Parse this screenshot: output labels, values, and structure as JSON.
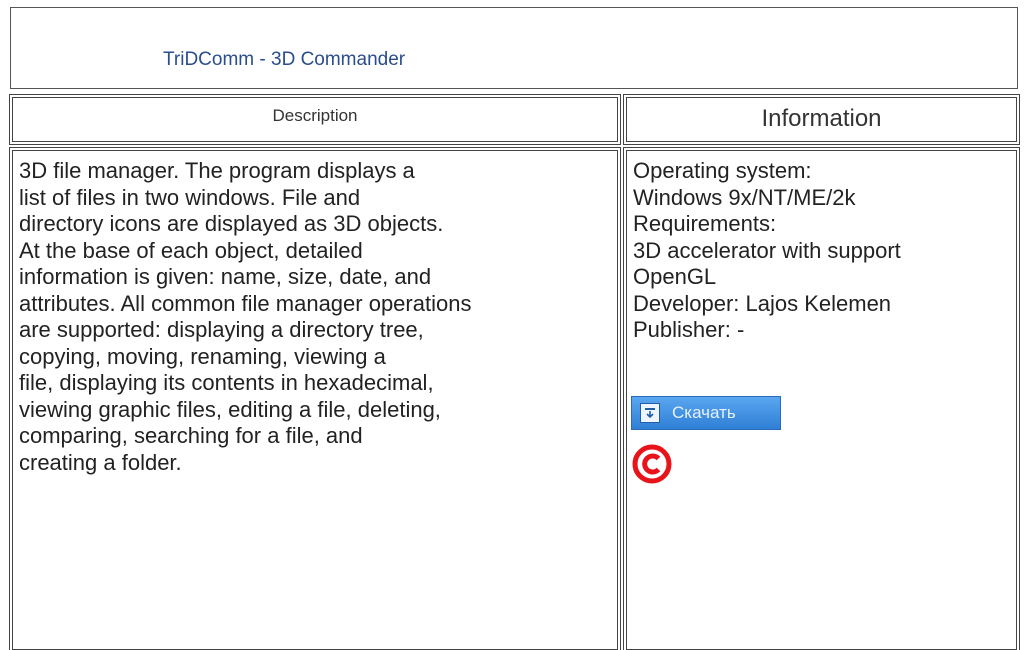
{
  "page": {
    "title": "TriDComm - 3D Commander"
  },
  "table": {
    "headers": {
      "description": "Description",
      "information": "Information"
    },
    "description_lines": [
      "3D file manager. The program displays a",
      "list of files in two windows. File and",
      "directory icons are displayed as 3D objects.",
      "At the base of each object, detailed",
      "information is given: name, size, date, and",
      "attributes. All common file manager operations",
      "are supported: displaying a directory tree,",
      "copying, moving, renaming, viewing a",
      "file, displaying its contents in hexadecimal,",
      "viewing graphic files, editing a file, deleting,",
      "comparing, searching for a file, and",
      "creating a folder."
    ],
    "information_lines": [
      "Operating system:",
      "Windows 9x/NT/ME/2k",
      "Requirements:",
      "3D accelerator with support",
      "OpenGL",
      "Developer: Lajos Kelemen",
      "Publisher: -"
    ],
    "download_button": {
      "label": "Скачать",
      "icon": "download-arrow-icon",
      "color": "#2f7fd6"
    },
    "copyright_icon": {
      "icon": "copyright-icon",
      "color": "#e8141b"
    }
  }
}
